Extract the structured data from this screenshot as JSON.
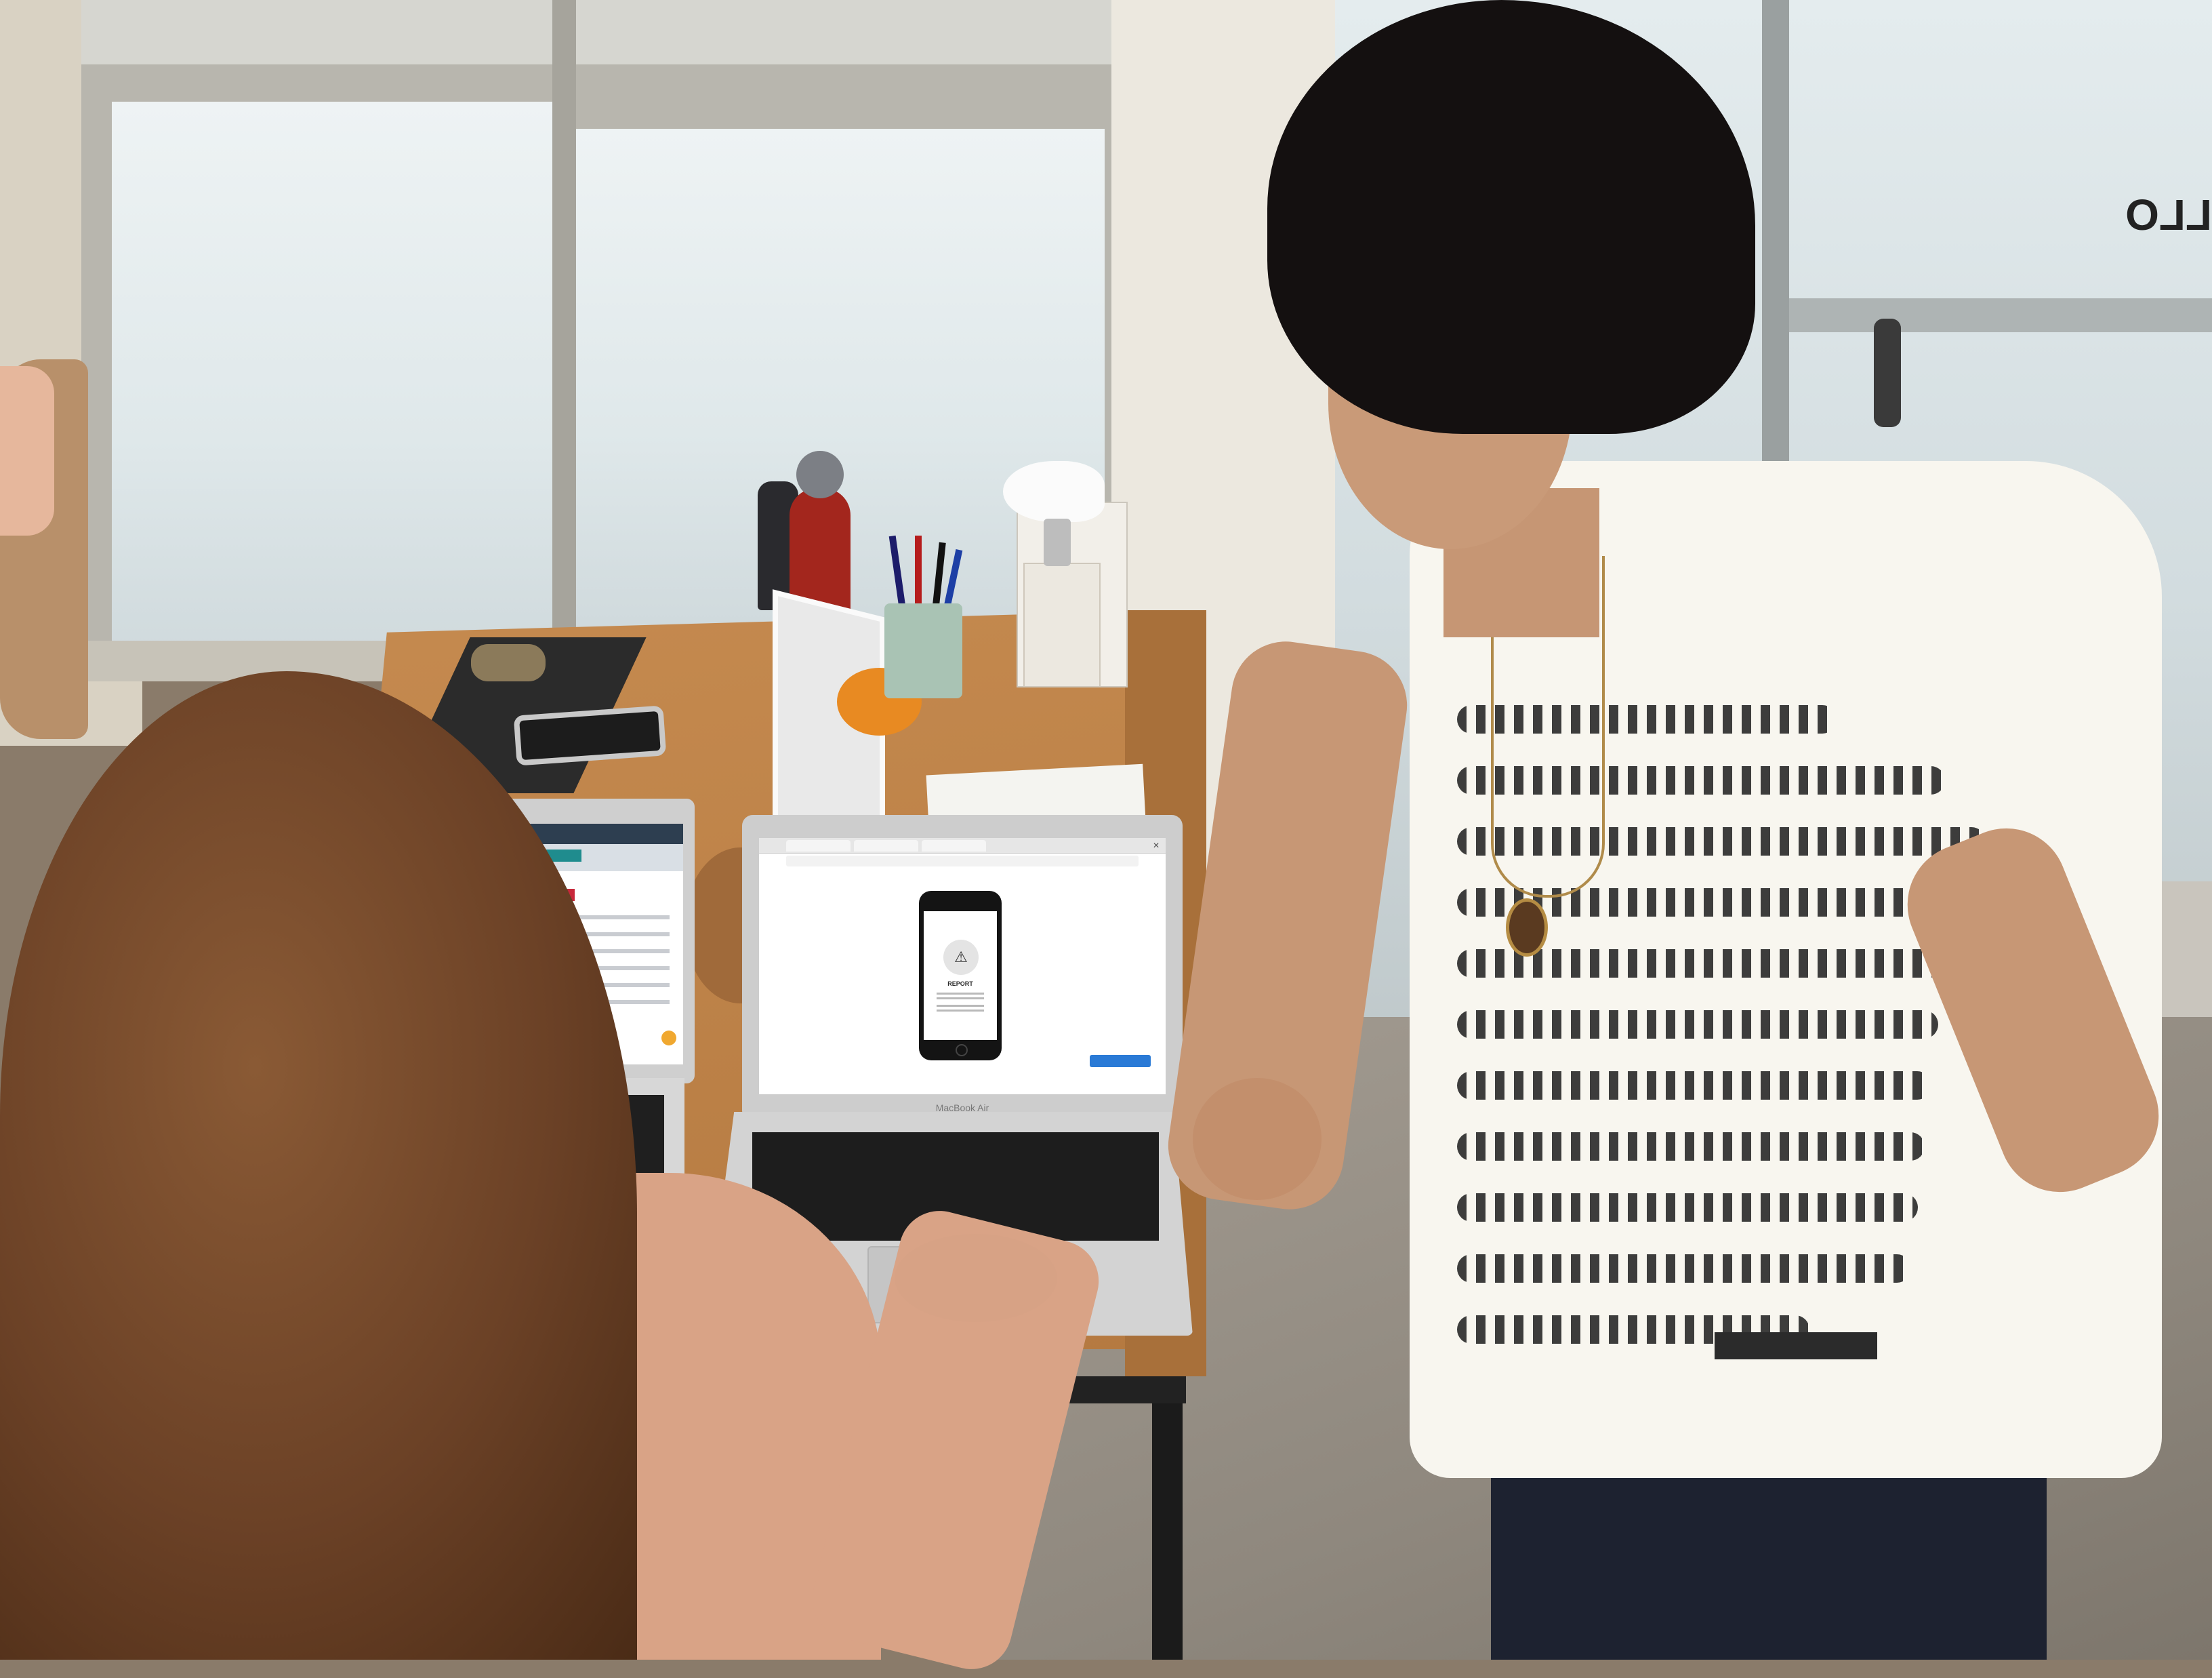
{
  "scene": {
    "door_lettering": "LLO",
    "laptop_model_label": "MacBook Air"
  },
  "prototype_screen": {
    "card_title": "REPORT"
  }
}
